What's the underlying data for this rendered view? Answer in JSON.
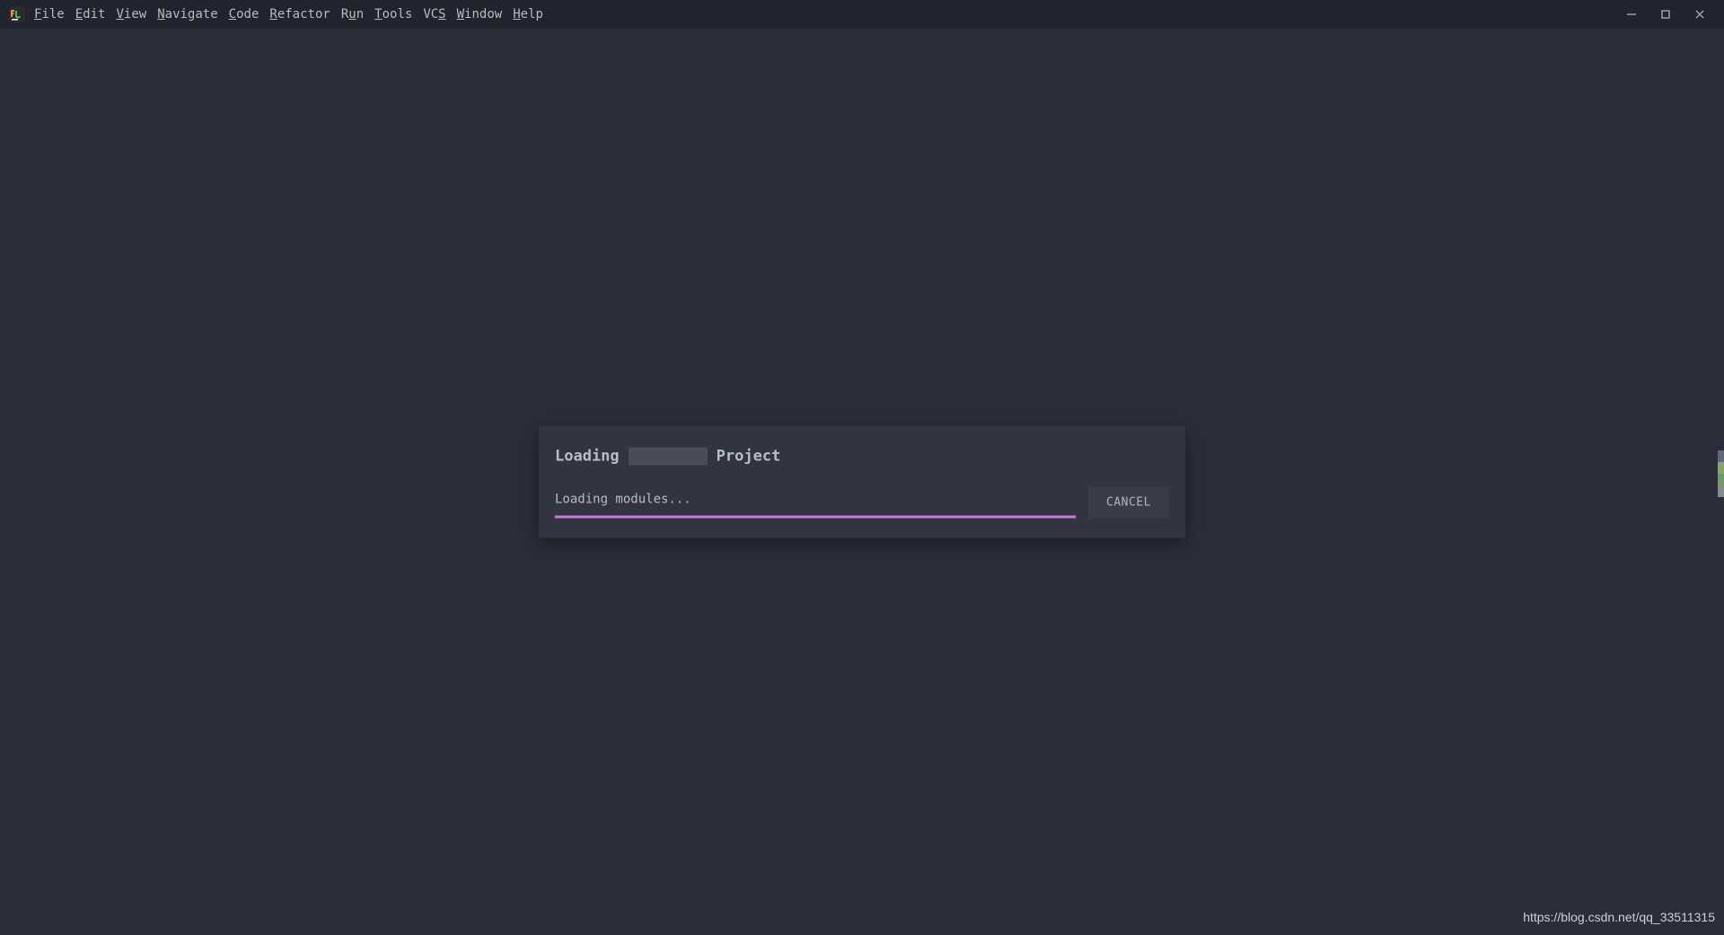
{
  "menubar": {
    "items": [
      {
        "label": "File",
        "prefix": "F",
        "rest": "ile"
      },
      {
        "label": "Edit",
        "prefix": "E",
        "rest": "dit"
      },
      {
        "label": "View",
        "prefix": "V",
        "rest": "iew"
      },
      {
        "label": "Navigate",
        "prefix": "N",
        "rest": "avigate"
      },
      {
        "label": "Code",
        "prefix": "C",
        "rest": "ode"
      },
      {
        "label": "Refactor",
        "prefix": "R",
        "rest": "efactor"
      },
      {
        "label": "Run",
        "prefix": "R",
        "rest": "u",
        "suffix": "n"
      },
      {
        "label": "Tools",
        "prefix": "T",
        "rest": "ools"
      },
      {
        "label": "VCS",
        "prefix": "VC",
        "rest": "",
        "suffix": "",
        "ul": "S"
      },
      {
        "label": "Window",
        "prefix": "W",
        "rest": "indow"
      },
      {
        "label": "Help",
        "prefix": "H",
        "rest": "elp"
      }
    ]
  },
  "dialog": {
    "title_prefix": "Loading",
    "title_suffix": "Project",
    "progress_text": "Loading modules...",
    "cancel_label": "CANCEL",
    "progress_color": "#c678dd",
    "progress_percent": 100
  },
  "watermark": "https://blog.csdn.net/qq_33511315",
  "side_indicator": {
    "colors": [
      "#5e6a7a",
      "#8aa36b",
      "#6f9a6a",
      "#8a8a8a"
    ]
  }
}
